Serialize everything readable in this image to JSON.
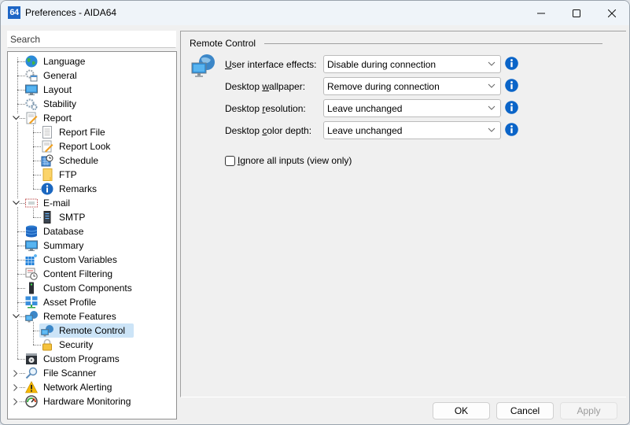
{
  "window": {
    "app_icon_text": "64",
    "title": "Preferences - AIDA64",
    "minimize_glyph": "—",
    "maximize_glyph": "☐",
    "close_glyph": "✕"
  },
  "search": {
    "placeholder": "Search",
    "value": ""
  },
  "tree": {
    "items": [
      {
        "label": "Language",
        "icon": "globe-icon",
        "level": 0
      },
      {
        "label": "General",
        "icon": "gear-window-icon",
        "level": 0
      },
      {
        "label": "Layout",
        "icon": "monitor-icon",
        "level": 0
      },
      {
        "label": "Stability",
        "icon": "gears-icon",
        "level": 0
      },
      {
        "label": "Report",
        "icon": "report-pencil-icon",
        "level": 0,
        "expanded": true
      },
      {
        "label": "Report File",
        "icon": "document-icon",
        "level": 1
      },
      {
        "label": "Report Look",
        "icon": "report-pencil-icon",
        "level": 1
      },
      {
        "label": "Schedule",
        "icon": "schedule-clock-icon",
        "level": 1
      },
      {
        "label": "FTP",
        "icon": "folder-icon",
        "level": 1
      },
      {
        "label": "Remarks",
        "icon": "info-icon",
        "level": 1
      },
      {
        "label": "E-mail",
        "icon": "envelope-icon",
        "level": 0,
        "expanded": true
      },
      {
        "label": "SMTP",
        "icon": "server-icon",
        "level": 1
      },
      {
        "label": "Database",
        "icon": "database-icon",
        "level": 0
      },
      {
        "label": "Summary",
        "icon": "monitor-icon",
        "level": 0
      },
      {
        "label": "Custom Variables",
        "icon": "grid-icon",
        "level": 0
      },
      {
        "label": "Content Filtering",
        "icon": "filter-clock-icon",
        "level": 0
      },
      {
        "label": "Custom Components",
        "icon": "tower-icon",
        "level": 0
      },
      {
        "label": "Asset Profile",
        "icon": "network-icon",
        "level": 0
      },
      {
        "label": "Remote Features",
        "icon": "remote-globe-monitor-icon",
        "level": 0,
        "expanded": true
      },
      {
        "label": "Remote Control",
        "icon": "remote-globe-monitor-icon",
        "level": 1,
        "selected": true
      },
      {
        "label": "Security",
        "icon": "lock-icon",
        "level": 1
      },
      {
        "label": "Custom Programs",
        "icon": "disk-drive-icon",
        "level": 0
      },
      {
        "label": "File Scanner",
        "icon": "magnifier-icon",
        "level": 0,
        "collapsed": true
      },
      {
        "label": "Network Alerting",
        "icon": "warning-icon",
        "level": 0,
        "collapsed": true
      },
      {
        "label": "Hardware Monitoring",
        "icon": "gauge-icon",
        "level": 0,
        "collapsed": true
      }
    ]
  },
  "panel": {
    "group_title": "Remote Control",
    "rows": [
      {
        "label_pre": "",
        "label_ul": "U",
        "label_post": "ser interface effects:",
        "value": "Disable during connection"
      },
      {
        "label_pre": "Desktop ",
        "label_ul": "w",
        "label_post": "allpaper:",
        "value": "Remove during connection"
      },
      {
        "label_pre": "Desktop ",
        "label_ul": "r",
        "label_post": "esolution:",
        "value": "Leave unchanged"
      },
      {
        "label_pre": "Desktop ",
        "label_ul": "c",
        "label_post": "olor depth:",
        "value": "Leave unchanged"
      }
    ],
    "checkbox": {
      "label_ul": "I",
      "label_post": "gnore all inputs (view only)",
      "checked": false
    }
  },
  "buttons": {
    "ok": "OK",
    "cancel": "Cancel",
    "apply": "Apply"
  },
  "colors": {
    "accent": "#1e66c6",
    "selection": "#cce4f7",
    "info": "#0a64c8"
  }
}
